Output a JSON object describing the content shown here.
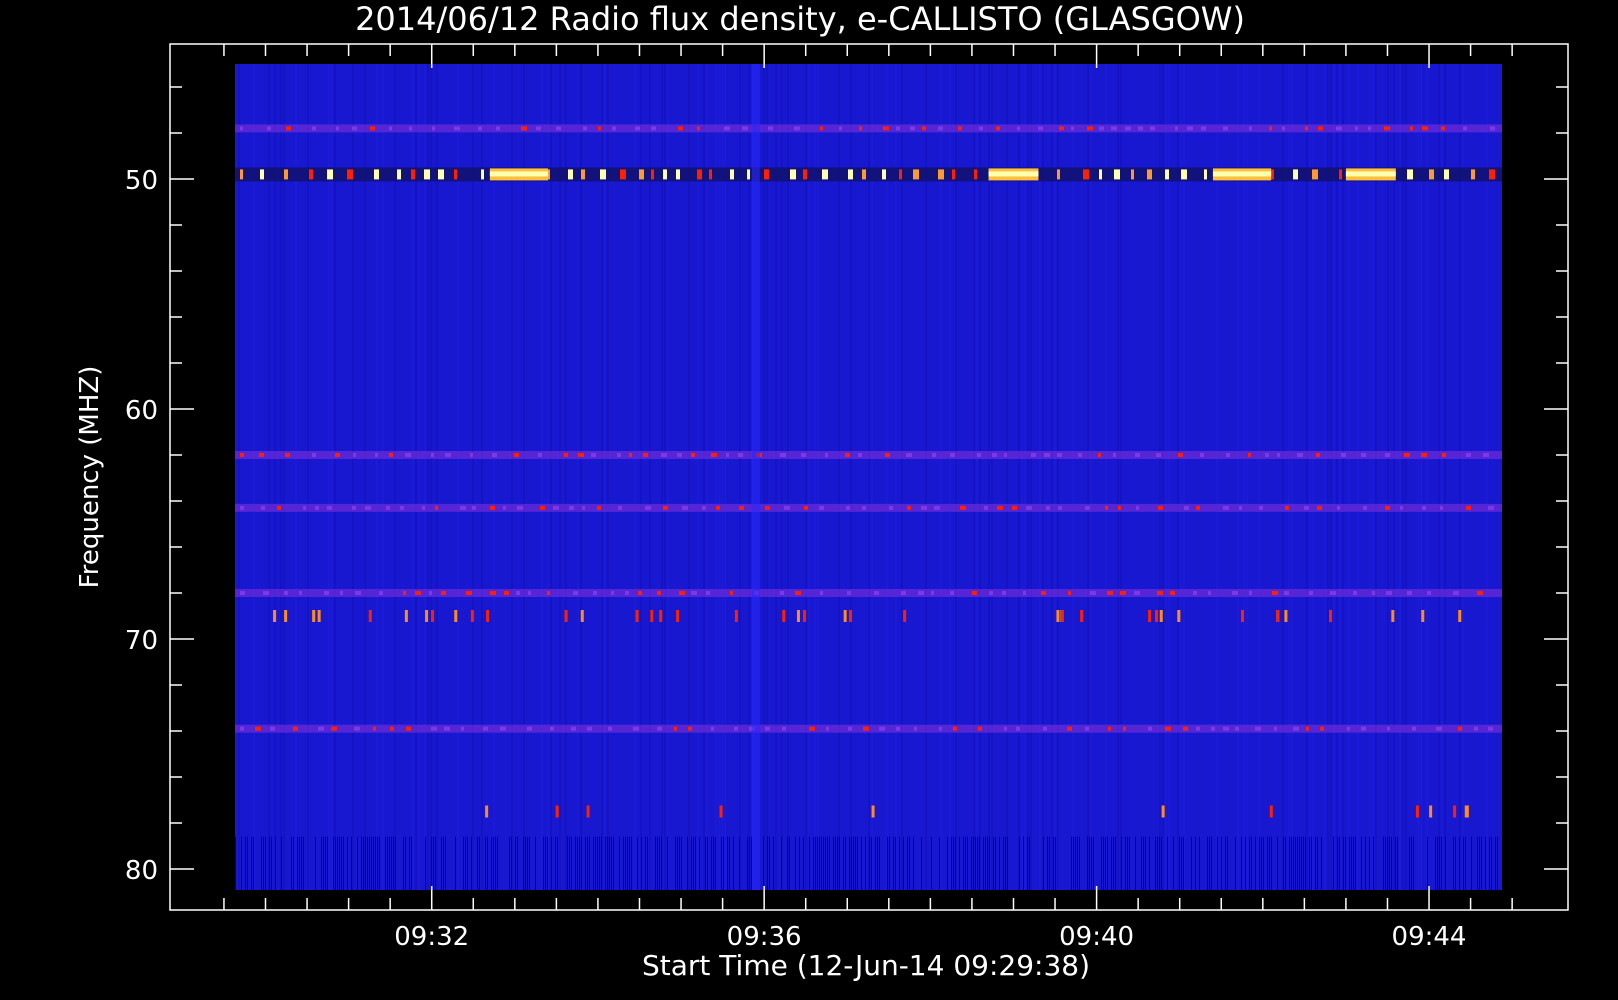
{
  "chart_data": {
    "type": "heatmap",
    "title": "2014/06/12  Radio flux density, e-CALLISTO (GLASGOW)",
    "xlabel": "Start Time (12-Jun-14 09:29:38)",
    "ylabel": "Frequency (MHZ)",
    "x_ticks": [
      "09:32",
      "09:36",
      "09:40",
      "09:44"
    ],
    "y_ticks": [
      "50",
      "60",
      "70",
      "80"
    ],
    "x_tick_minutes": [
      32,
      36,
      40,
      44
    ],
    "y_tick_values": [
      50,
      60,
      70,
      80
    ],
    "xlim_minutes": [
      29.4,
      45.0
    ],
    "ylim_mhz": [
      45,
      82
    ],
    "y_inverted": true,
    "colormap": "blue-red-yellow-white",
    "colors": {
      "background": "#000000",
      "low": "#1818d0",
      "mid": "#6a2ad8",
      "high": "#ff2000",
      "peak": "#ffffb0"
    },
    "features": [
      {
        "kind": "persistent-band",
        "freq_mhz": 49.8,
        "level": "high"
      },
      {
        "kind": "persistent-band",
        "freq_mhz": 47.8,
        "level": "mid"
      },
      {
        "kind": "persistent-band",
        "freq_mhz": 62.0,
        "level": "mid"
      },
      {
        "kind": "persistent-band",
        "freq_mhz": 64.3,
        "level": "mid"
      },
      {
        "kind": "persistent-band",
        "freq_mhz": 68.0,
        "level": "mid"
      },
      {
        "kind": "persistent-band",
        "freq_mhz": 73.9,
        "level": "mid"
      },
      {
        "kind": "intermittent",
        "freq_mhz": 69.0,
        "level": "high"
      },
      {
        "kind": "intermittent",
        "freq_mhz": 77.5,
        "level": "high"
      },
      {
        "kind": "vertical-streak",
        "time_min": 35.9,
        "level": "low"
      }
    ]
  }
}
